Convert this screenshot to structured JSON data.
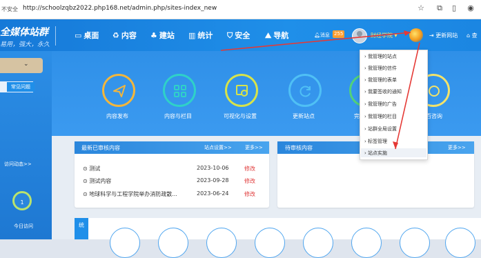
{
  "browser": {
    "security_badge": "不安全",
    "url": "http://schoolzqbz2022.php168.net/admin.php/sites-index_new",
    "icons": [
      "star-icon",
      "puzzle-icon",
      "sidebar-icon",
      "profile-icon"
    ]
  },
  "brand": {
    "title": "全媒体站群",
    "slogan": "易用，强大，永久"
  },
  "nav": [
    {
      "label": "桌面",
      "icon": "desktop-icon"
    },
    {
      "label": "内容",
      "icon": "recycle-icon"
    },
    {
      "label": "建站",
      "icon": "tree-icon"
    },
    {
      "label": "统计",
      "icon": "bar-chart-icon"
    },
    {
      "label": "安全",
      "icon": "shield-icon"
    },
    {
      "label": "导航",
      "icon": "map-icon"
    }
  ],
  "header": {
    "message_label": "消息",
    "message_count": "255",
    "username": "财经学院",
    "update_label": "更新网站",
    "home_label": "查"
  },
  "sidebar": {
    "tab_label": "常见问题",
    "visit_label": "访问动态>>",
    "visit_count": "1",
    "today_label": "今日访问"
  },
  "quick_actions": [
    {
      "label": "内容发布",
      "icon": "paper-plane-icon"
    },
    {
      "label": "内容与栏目",
      "icon": "grid-icon"
    },
    {
      "label": "可视化与设置",
      "icon": "visual-settings-icon"
    },
    {
      "label": "更新站点",
      "icon": "refresh-icon"
    },
    {
      "label": "完",
      "icon": "partial-icon"
    },
    {
      "label": "百咨询",
      "icon": "consult-icon"
    }
  ],
  "recent_reviewed": {
    "title": "最新已审核内容",
    "settings_link": "站点设置>>",
    "more_link": "更多>>",
    "rows": [
      {
        "title": "测试",
        "date": "2023-10-06",
        "action": "修改"
      },
      {
        "title": "测试内容",
        "date": "2023-09-28",
        "action": "修改"
      },
      {
        "title": "地球科学与工程学院举办消防疏散...",
        "date": "2023-06-24",
        "action": "修改"
      }
    ]
  },
  "pending": {
    "title": "待审核内容",
    "more_link": "更多>>"
  },
  "dropdown": {
    "items": [
      "我管理的站点",
      "我管理的信件",
      "我管理的表单",
      "我要签收的通知",
      "我管理的广告",
      "我管理的栏目",
      "站群全局设置",
      "标签管理",
      "站点实施"
    ]
  },
  "bottom": {
    "stat_label": "统"
  },
  "colors": {
    "header_blue": "#1f8fe9",
    "accent_yellow": "#ffe36a",
    "badge_orange": "#ff9d2e",
    "edit_red": "#e03b3b",
    "arrow_red": "#e53935"
  }
}
